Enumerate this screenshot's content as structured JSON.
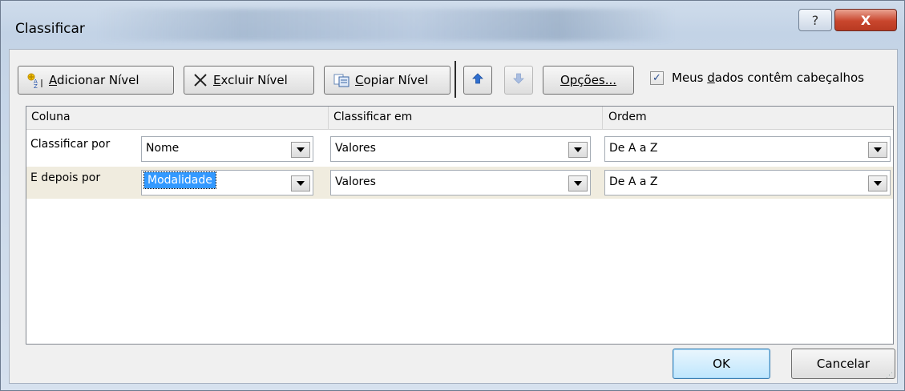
{
  "window": {
    "title": "Classificar",
    "help_label": "?",
    "close_label": "X"
  },
  "toolbar": {
    "add_level": {
      "prefix": "",
      "underline": "A",
      "rest": "dicionar Nível"
    },
    "delete_level": {
      "prefix": "",
      "underline": "E",
      "rest": "xcluir Nível"
    },
    "copy_level": {
      "prefix": "",
      "underline": "C",
      "rest": "opiar Nível"
    },
    "options": {
      "prefix": "Op",
      "underline": "ç",
      "rest": "ões..."
    },
    "header_checkbox": {
      "checked": true,
      "prefix": "Meus ",
      "underline": "d",
      "rest": "ados contêm cabeçalhos"
    }
  },
  "grid": {
    "headers": [
      "Coluna",
      "Classificar em",
      "Ordem"
    ],
    "rows": [
      {
        "label": "Classificar por",
        "column": "Nome",
        "sort_on": "Valores",
        "order": "De A a Z",
        "selected": false
      },
      {
        "label": "E depois por",
        "column": "Modalidade",
        "sort_on": "Valores",
        "order": "De A a Z",
        "selected": true
      }
    ]
  },
  "footer": {
    "ok_label": "OK",
    "cancel_label": "Cancelar"
  },
  "icons": {
    "add_level": "sort-az-add-icon",
    "delete_level": "x-icon",
    "copy_level": "copy-icon",
    "move_up": "arrow-up-icon",
    "move_down": "arrow-down-icon",
    "dropdown": "chevron-down-icon",
    "checkbox": "check-icon"
  },
  "colors": {
    "accent_blue": "#3399ff",
    "close_red": "#c9462d",
    "selected_row": "#f0ecdf"
  }
}
